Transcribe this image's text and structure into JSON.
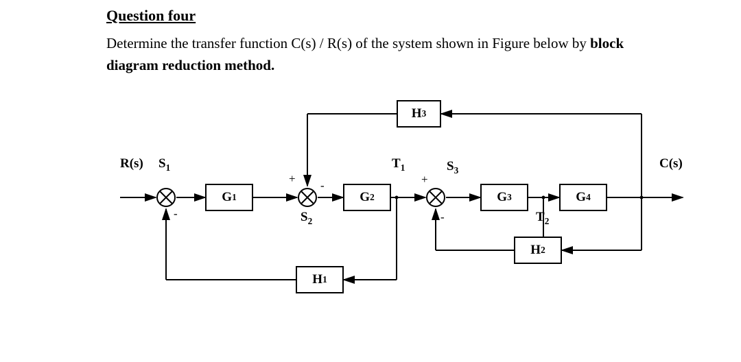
{
  "title": "Question four",
  "text_part1": "Determine the transfer function C(s) / R(s) of the system shown in Figure below by ",
  "text_part2": "block diagram reduction method.",
  "labels": {
    "Rs": "R(s)",
    "Cs": "C(s)",
    "S1": "S",
    "S1_sub": "1",
    "S2": "S",
    "S2_sub": "2",
    "S3": "S",
    "S3_sub": "3",
    "T1": "T",
    "T1_sub": "1",
    "T2": "T",
    "T2_sub": "2",
    "G1": "G",
    "G1_sub": "1",
    "G2": "G",
    "G2_sub": "2",
    "G3": "G",
    "G3_sub": "3",
    "G4": "G",
    "G4_sub": "4",
    "H1": "H",
    "H1_sub": "1",
    "H2": "H",
    "H2_sub": "2",
    "H3": "H",
    "H3_sub": "3"
  },
  "signs": {
    "s1_top": "",
    "s1_bot": "-",
    "s2_top": "+",
    "s2_right": "-",
    "s3_top": "+",
    "s3_bot": "-"
  }
}
